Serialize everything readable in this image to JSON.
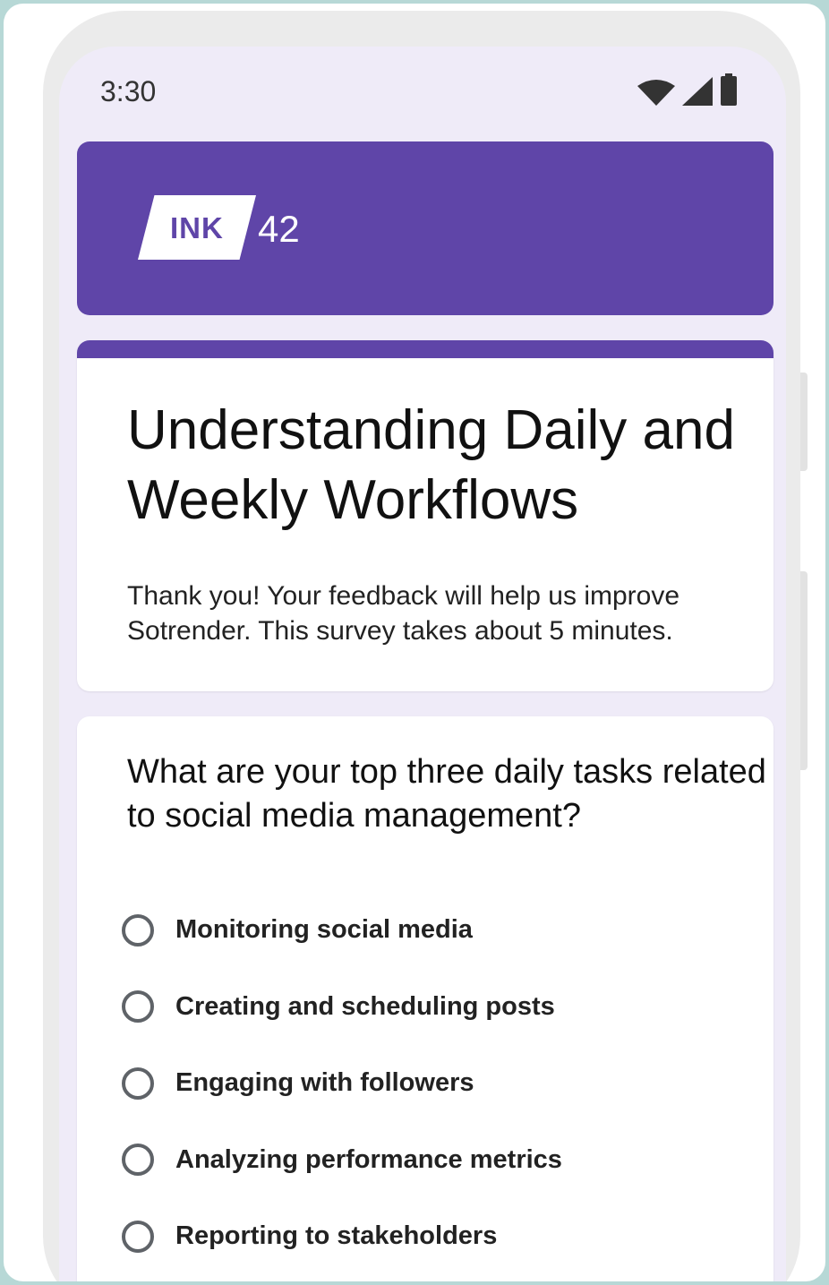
{
  "status_bar": {
    "time": "3:30",
    "icons": [
      "wifi-icon",
      "signal-icon",
      "battery-icon"
    ]
  },
  "brand": {
    "logo_text": "INK",
    "logo_number": "42",
    "color": "#5f45a8"
  },
  "survey": {
    "title": "Understanding Daily and Weekly Workflows",
    "description": "Thank you! Your feedback will help us improve Sotrender. This survey takes about 5 minutes."
  },
  "question": {
    "text": "What are your top three daily tasks related to social media management?",
    "options": [
      {
        "label": "Monitoring social media",
        "selected": false
      },
      {
        "label": "Creating and scheduling posts",
        "selected": false
      },
      {
        "label": "Engaging with followers",
        "selected": false
      },
      {
        "label": "Analyzing performance metrics",
        "selected": false
      },
      {
        "label": "Reporting to stakeholders",
        "selected": false
      }
    ]
  },
  "colors": {
    "page_background": "#b7d8d6",
    "screen_background": "#efebf8",
    "accent": "#5f45a8"
  }
}
